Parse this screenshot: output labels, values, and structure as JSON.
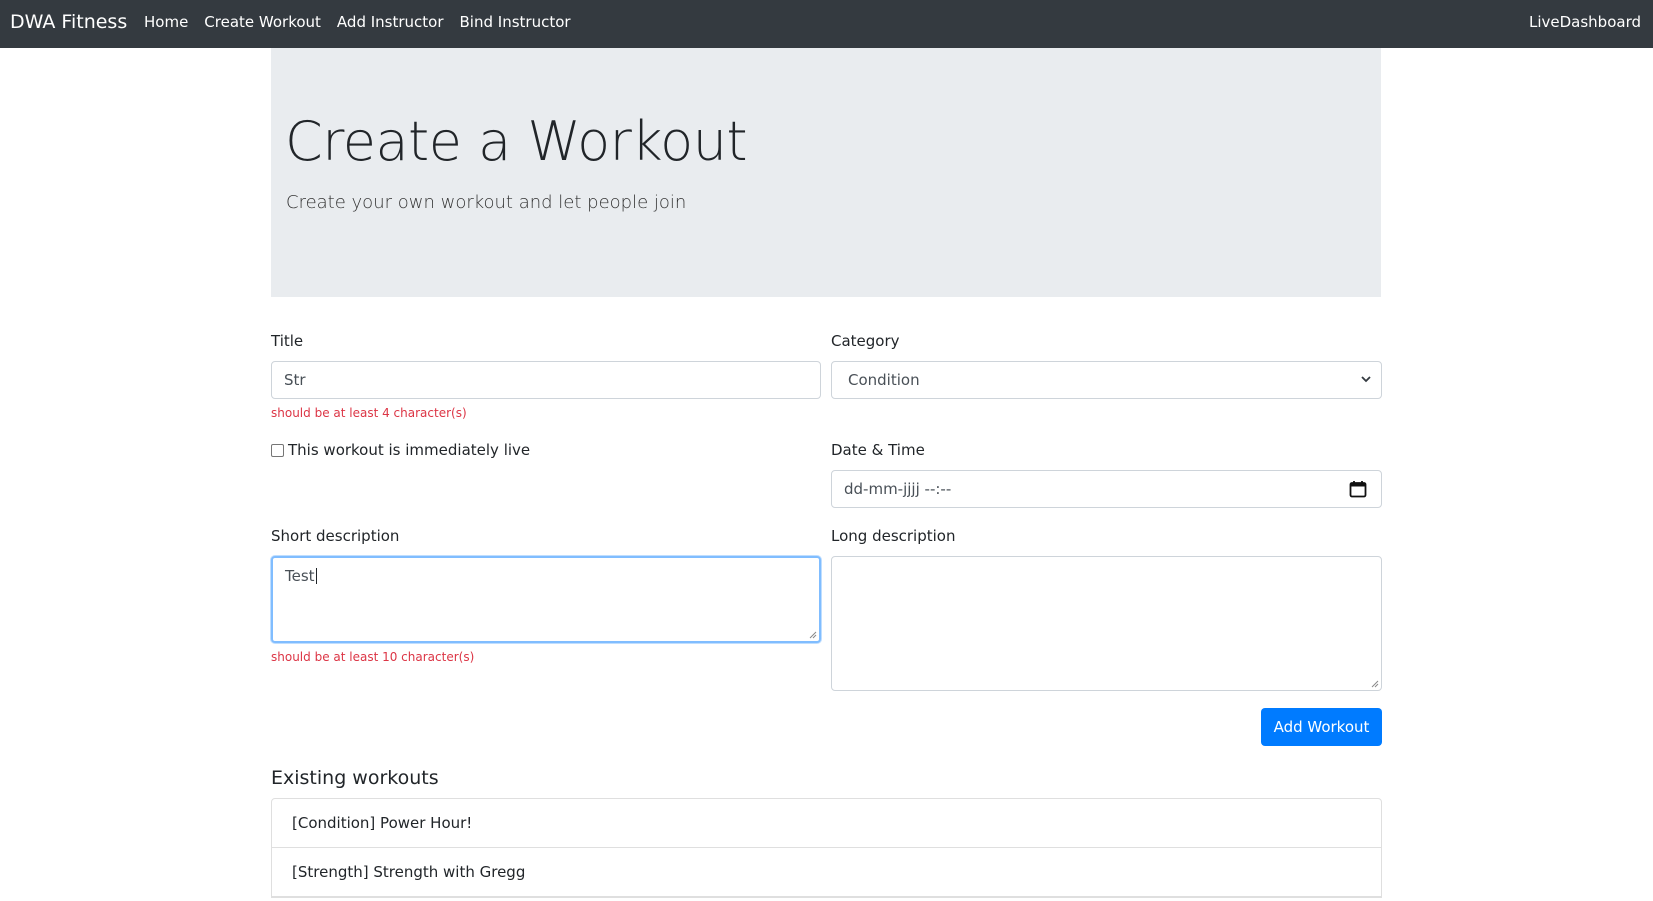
{
  "navbar": {
    "brand": "DWA Fitness",
    "links": [
      "Home",
      "Create Workout",
      "Add Instructor",
      "Bind Instructor"
    ],
    "right_link": "LiveDashboard",
    "background": "#343a40"
  },
  "jumbotron": {
    "title": "Create a Workout",
    "lead": "Create your own workout and let people join"
  },
  "form": {
    "title": {
      "label": "Title",
      "value": "Str",
      "error": "should be at least 4 character(s)"
    },
    "category": {
      "label": "Category",
      "selected": "Condition"
    },
    "live_checkbox": {
      "label": "This workout is immediately live",
      "checked": false
    },
    "datetime": {
      "label": "Date & Time",
      "placeholder": "dd-mm-jjjj --:--"
    },
    "short_description": {
      "label": "Short description",
      "value": "Test",
      "error": "should be at least 10 character(s)"
    },
    "long_description": {
      "label": "Long description",
      "value": ""
    },
    "submit_label": "Add Workout"
  },
  "existing": {
    "heading": "Existing workouts",
    "items": [
      "[Condition] Power Hour!",
      "[Strength] Strength with Gregg"
    ]
  },
  "colors": {
    "primary": "#007bff",
    "error": "#dc3545",
    "jumbotron_bg": "#e9ecef"
  }
}
